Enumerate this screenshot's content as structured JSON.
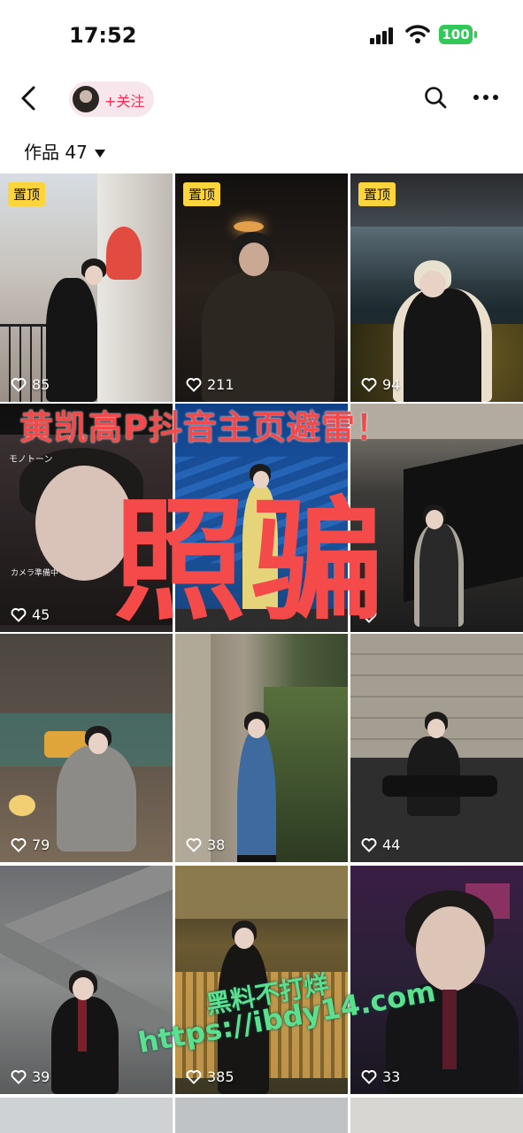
{
  "status": {
    "time": "17:52",
    "battery": "100"
  },
  "nav": {
    "follow_label": "+关注"
  },
  "works": {
    "label": "作品 47"
  },
  "pin_label": "置顶",
  "tiles": [
    {
      "likes": "85",
      "pinned": true
    },
    {
      "likes": "211",
      "pinned": true
    },
    {
      "likes": "94",
      "pinned": true
    },
    {
      "likes": "45",
      "pinned": false
    },
    {
      "likes": "",
      "pinned": false
    },
    {
      "likes": "",
      "pinned": false
    },
    {
      "likes": "79",
      "pinned": false
    },
    {
      "likes": "38",
      "pinned": false
    },
    {
      "likes": "44",
      "pinned": false
    },
    {
      "likes": "39",
      "pinned": false
    },
    {
      "likes": "385",
      "pinned": false
    },
    {
      "likes": "33",
      "pinned": false
    }
  ],
  "tile3_text": {
    "top": "モノトーン",
    "bottom": "カメラ準備中"
  },
  "overlay": {
    "title": "黄凯高P抖音主页避雷！",
    "big": "照骗"
  },
  "watermark": {
    "line1": "黑料不打烊",
    "line2": "https://ibdy14.com"
  },
  "colors": {
    "accent": "#fe2c55",
    "pin_bg": "#fcd53c",
    "overlay_red": "#f44a4a",
    "watermark_green": "#5ce08e",
    "battery_green": "#34c759"
  }
}
